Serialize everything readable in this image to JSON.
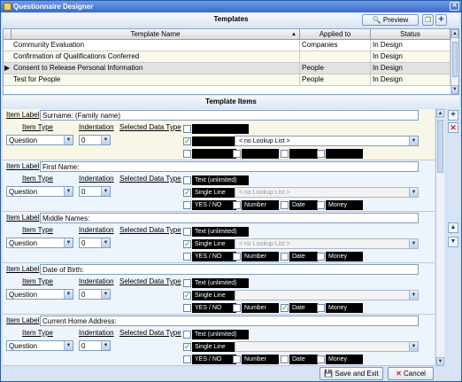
{
  "window": {
    "title": "Questionnaire Designer"
  },
  "templates": {
    "heading": "Templates",
    "preview_label": "Preview",
    "columns": [
      "Template Name",
      "Applied to",
      "Status"
    ],
    "rows": [
      {
        "name": "Community Evaluation",
        "applied": "Companies",
        "status": "In Design"
      },
      {
        "name": "Confirmation of Qualifications Conferred",
        "applied": "",
        "status": "In Design"
      },
      {
        "name": "Consent to Release Personal Information",
        "applied": "People",
        "status": "In Design"
      },
      {
        "name": "Test for People",
        "applied": "People",
        "status": "In Design"
      }
    ]
  },
  "items_section": {
    "heading": "Template Items"
  },
  "labels": {
    "item_label": "Item Label",
    "item_type": "Item Type",
    "indentation": "Indentation",
    "selected_data_type": "Selected Data Type"
  },
  "items": [
    {
      "label": "Surname: (Family name)",
      "type": "Question",
      "indent": "0",
      "opt_text": "",
      "opt_single": "",
      "opt_yesno": "",
      "opt_number": "",
      "opt_date": "",
      "opt_money": "",
      "lookup": "< no Lookup List >"
    },
    {
      "label": "First Name:",
      "type": "Question",
      "indent": "0",
      "opt_text": "Text (unlimited)",
      "opt_single": "Single Line",
      "opt_yesno": "YES / NO",
      "opt_number": "Number",
      "opt_date": "Date",
      "opt_money": "Money",
      "lookup": "< no Lookup List >"
    },
    {
      "label": "Middle Names:",
      "type": "Question",
      "indent": "0",
      "opt_text": "Text (unlimited)",
      "opt_single": "Single Line",
      "opt_yesno": "YES / NO",
      "opt_number": "Number",
      "opt_date": "Date",
      "opt_money": "Money",
      "lookup": "< no Lookup List >"
    },
    {
      "label": "Date of Birth:",
      "type": "Question",
      "indent": "0",
      "opt_text": "Text (unlimited)",
      "opt_single": "Single Line",
      "opt_yesno": "YES / NO",
      "opt_number": "Number",
      "opt_date": "Date",
      "opt_money": "Money",
      "lookup": ""
    },
    {
      "label": "Current Home Address:",
      "type": "Question",
      "indent": "0",
      "opt_text": "Text (unlimited)",
      "opt_single": "Single Line",
      "opt_yesno": "YES / NO",
      "opt_number": "Number",
      "opt_date": "Date",
      "opt_money": "Money",
      "lookup": ""
    }
  ],
  "footer": {
    "save_label": "Save and Exit",
    "cancel_label": "Cancel"
  }
}
